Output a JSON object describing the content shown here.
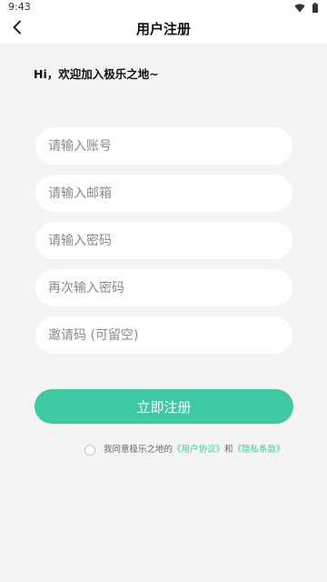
{
  "status_bar": {
    "time": "9:43",
    "icons": [
      "wifi-icon",
      "battery-icon"
    ]
  },
  "header": {
    "title": "用户注册",
    "back_icon": "chevron-left-icon"
  },
  "welcome_text": "Hi，欢迎加入极乐之地~",
  "form": {
    "account_placeholder": "请输入账号",
    "email_placeholder": "请输入邮箱",
    "password_placeholder": "请输入密码",
    "confirm_password_placeholder": "再次输入密码",
    "invite_code_placeholder": "邀请码 (可留空)",
    "submit_label": "立即注册"
  },
  "agreement": {
    "prefix": "我同意极乐之地的",
    "user_agreement": "《用户协议》",
    "conjunction": "和",
    "privacy_policy": "《隐私条款》",
    "checked": false
  },
  "colors": {
    "accent": "#3fc9a3",
    "background": "#f4f4f4",
    "surface": "#ffffff"
  }
}
